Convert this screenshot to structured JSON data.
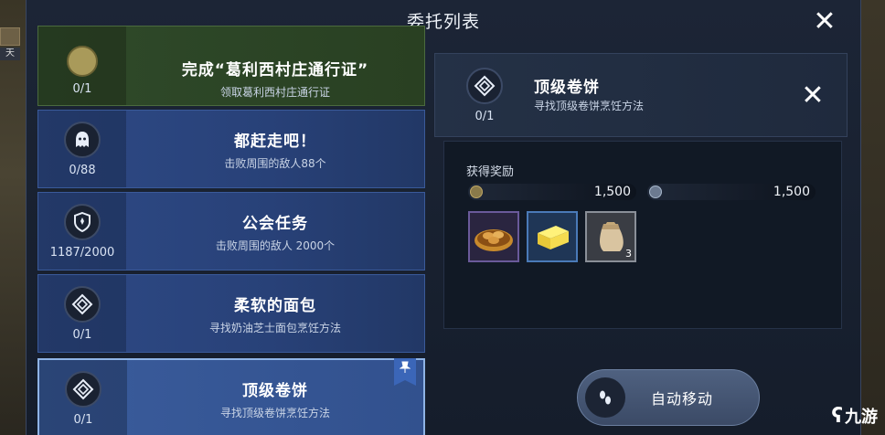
{
  "window": {
    "title": "委托列表"
  },
  "quests": [
    {
      "title": "完成“葛利西村庄通行证”",
      "subtitle": "领取葛利西村庄通行证",
      "progress": "0/1",
      "icon": "egg-icon",
      "state": "done"
    },
    {
      "title": "都赶走吧！",
      "subtitle": "击败周围的敌人88个",
      "progress": "0/88",
      "icon": "ghost-icon",
      "state": "normal"
    },
    {
      "title": "公会任务",
      "subtitle": "击败周围的敌人 2000个",
      "progress": "1187/2000",
      "icon": "shield-icon",
      "state": "normal"
    },
    {
      "title": "柔软的面包",
      "subtitle": "寻找奶油芝士面包烹饪方法",
      "progress": "0/1",
      "icon": "diamond-spiral-icon",
      "state": "normal"
    },
    {
      "title": "顶级卷饼",
      "subtitle": "寻找顶级卷饼烹饪方法",
      "progress": "0/1",
      "icon": "diamond-spiral-icon",
      "state": "selected"
    }
  ],
  "detail": {
    "title": "顶级卷饼",
    "subtitle": "寻找顶级卷饼烹饪方法",
    "progress": "0/1",
    "rewards_label": "获得奖励",
    "currencies": [
      {
        "icon": "gold-coin-icon",
        "amount": "1,500"
      },
      {
        "icon": "silver-coin-icon",
        "amount": "1,500"
      }
    ],
    "items": [
      {
        "icon": "bread-basket-icon",
        "qty": ""
      },
      {
        "icon": "butter-icon",
        "qty": ""
      },
      {
        "icon": "flour-sack-icon",
        "qty": "3"
      }
    ],
    "auto_move_label": "自动移动"
  },
  "background": {
    "left_badge": "天"
  },
  "watermark": {
    "text": "九游"
  },
  "colors": {
    "panel": "#1c2536",
    "quest_blue": "#2e4a86",
    "quest_done": "#2f4a2a",
    "accent": "#8fb4e6"
  }
}
